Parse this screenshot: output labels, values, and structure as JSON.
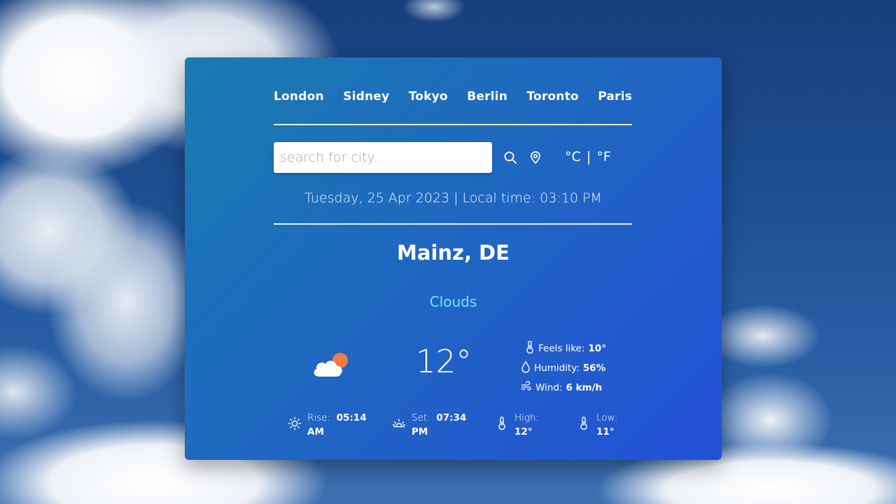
{
  "cities": [
    "London",
    "Sidney",
    "Tokyo",
    "Berlin",
    "Toronto",
    "Paris"
  ],
  "search": {
    "placeholder": "search for city..."
  },
  "units": {
    "celsius": "°C",
    "separator": "|",
    "fahrenheit": "°F"
  },
  "datetime": "Tuesday, 25 Apr 2023 | Local time: 03:10 PM",
  "location": "Mainz, DE",
  "condition": "Clouds",
  "temperature": "12°",
  "details": {
    "feels_like_label": "Feels like:",
    "feels_like": "10°",
    "humidity_label": "Humidity:",
    "humidity": "56%",
    "wind_label": "Wind:",
    "wind": "6 km/h"
  },
  "bottom": {
    "rise_label": "Rise:",
    "rise_time": "05:14",
    "rise_ampm": "AM",
    "set_label": "Set:",
    "set_time": "07:34",
    "set_ampm": "PM",
    "high_label": "High:",
    "high": "12°",
    "low_label": "Low:",
    "low": "11°"
  },
  "colors": {
    "panel_start": "#1a7bb0",
    "panel_end": "#2350d8",
    "condition_text": "#6ee7f9",
    "sun_orange": "#f07a4a"
  },
  "icons": [
    "search-icon",
    "location-pin-icon",
    "partly-cloudy-icon",
    "thermometer-icon",
    "droplet-icon",
    "wind-icon",
    "sunrise-icon",
    "sunset-icon"
  ]
}
